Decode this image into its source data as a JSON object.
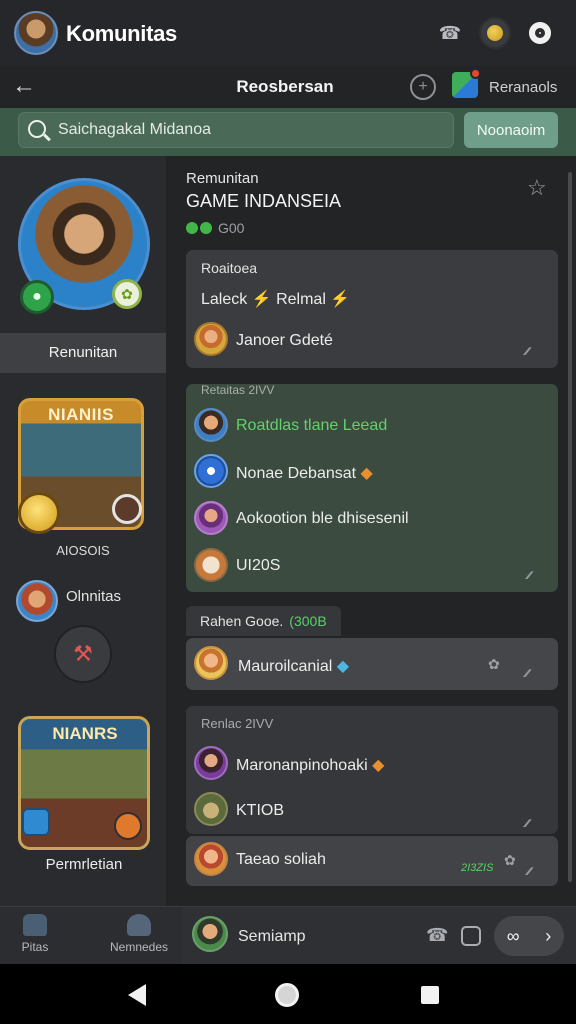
{
  "app": {
    "title": "Komunitas"
  },
  "header": {
    "title": "Reosbersan",
    "right_label": "Reranaols"
  },
  "search": {
    "value": "Saichagakal Midanoa",
    "button_label": "Noonaoim"
  },
  "sidebar": {
    "active_label": "Renunitan",
    "game1_title": "NIANIIS",
    "game1_label": "AIOSOIS",
    "user_label": "Olnnitas",
    "game2_title": "NIANRS",
    "game2_label": "Permrletian"
  },
  "community": {
    "label": "Remunitan",
    "name": "GAME INDANSEIA",
    "count": "G00"
  },
  "card1": {
    "title": "Roaitoea",
    "line_a": "Laleck",
    "line_b": "Relmal",
    "row": "Janoer Gdeté"
  },
  "card2": {
    "head": "Retaitas 2IVV",
    "rows": [
      "Roatdlas tlane  Leead",
      "Nonae Debansat",
      "Aokootion ble dhisesenil",
      "UI20S"
    ]
  },
  "tag": {
    "label": "Rahen Gooe.",
    "highlight": "(300B"
  },
  "card3": {
    "row": "Mauroilcanial"
  },
  "card4": {
    "head": "Renlac 2IVV",
    "rows": [
      "Maronanpinohoaki",
      "KTIOB"
    ]
  },
  "card5": {
    "row": "Taeao soliah",
    "green": "2I3ZIS"
  },
  "bottom_nav": {
    "home": "Pitas",
    "members": "Nemnedes"
  },
  "composer": {
    "value": "Semiamp"
  },
  "icons": {
    "back": "arrow-left-icon",
    "call": "phone-icon",
    "status": "status-icon",
    "settings": "gear-icon",
    "star": "star-icon"
  },
  "colors": {
    "background": "#232426",
    "accent_green": "#5bd06a",
    "search_bar": "#3c5a48",
    "search_button": "#6f9e8a"
  }
}
